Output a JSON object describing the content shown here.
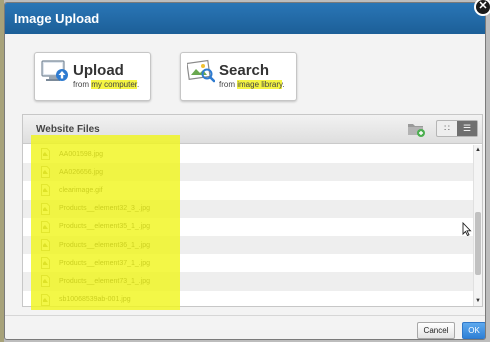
{
  "dialog": {
    "title": "Image Upload",
    "close_icon": "close-icon",
    "close_glyph": "✕"
  },
  "sources": {
    "upload": {
      "title": "Upload",
      "sub_prefix": "from ",
      "sub_highlight": "my computer",
      "sub_suffix": ".",
      "icon": "computer-upload-icon"
    },
    "search": {
      "title": "Search",
      "sub_prefix": "from ",
      "sub_highlight": "image library",
      "sub_suffix": ".",
      "icon": "image-search-icon"
    }
  },
  "files": {
    "title": "Website Files",
    "new_folder_icon": "new-folder-icon",
    "view_grid_icon": "grid-view-icon",
    "view_list_icon": "list-view-icon",
    "view_grid_glyph": "∷",
    "view_list_glyph": "☰",
    "items": [
      "AA001598.jpg",
      "AA026656.jpg",
      "clearimage.gif",
      "Products__element32_3_.jpg",
      "Products__element35_1_.jpg",
      "Products__element36_1_.jpg",
      "Products__element37_1_.jpg",
      "Products__element73_1_.jpg",
      "sb10068539ab-001.jpg"
    ],
    "scroll_up_glyph": "▲",
    "scroll_down_glyph": "▼"
  },
  "footer": {
    "cancel_label": "Cancel",
    "ok_label": "OK"
  },
  "colors": {
    "titlebar": "#1f66a3",
    "highlight": "#f0f51e",
    "ok_button": "#2f80d6"
  }
}
